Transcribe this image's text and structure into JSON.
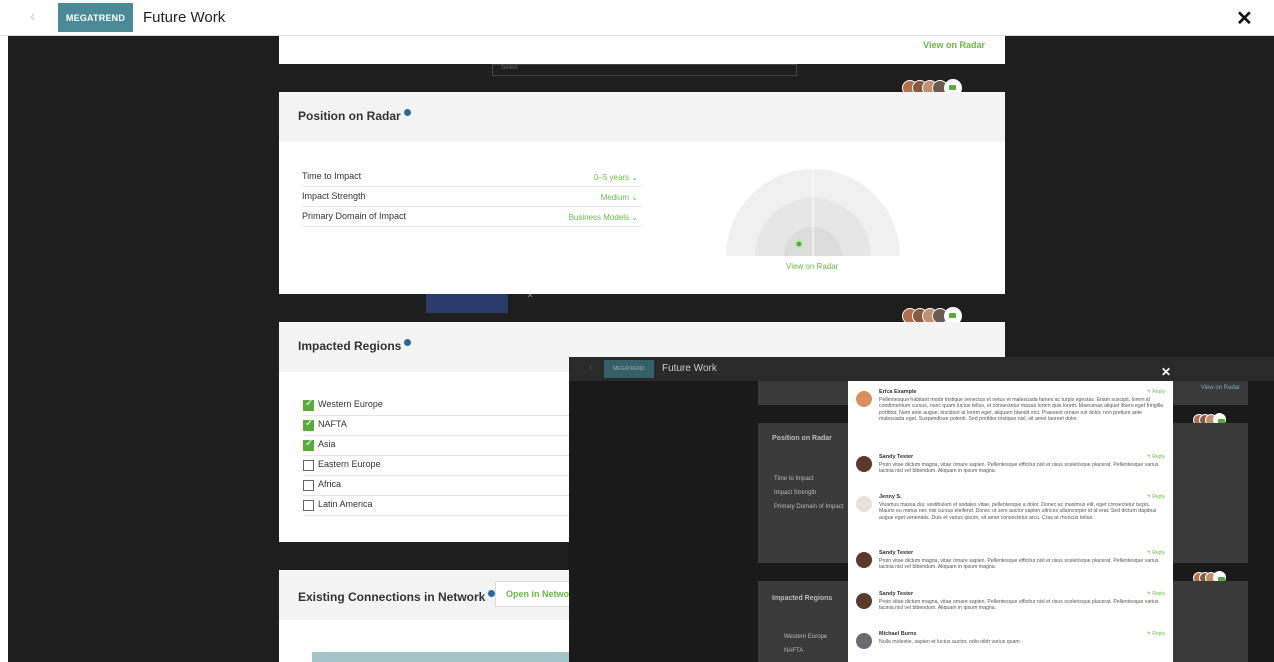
{
  "header": {
    "back_icon": "‹",
    "badge": "MEGATREND",
    "title": "Future Work",
    "close_icon": "✕"
  },
  "top_card": {
    "link": "View on Radar",
    "ghost_text": "Select"
  },
  "radar_card": {
    "title": "Position on Radar",
    "rows": [
      {
        "label": "Time to Impact",
        "value": "0–5 years"
      },
      {
        "label": "Impact Strength",
        "value": "Medium"
      },
      {
        "label": "Primary Domain of Impact",
        "value": "Business Models"
      }
    ],
    "link": "View on Radar"
  },
  "regions_card": {
    "title": "Impacted Regions",
    "items": [
      {
        "label": "Western Europe",
        "checked": true
      },
      {
        "label": "NAFTA",
        "checked": true
      },
      {
        "label": "Asia",
        "checked": true
      },
      {
        "label": "Eastern Europe",
        "checked": false
      },
      {
        "label": "Africa",
        "checked": false
      },
      {
        "label": "Latin America",
        "checked": false
      }
    ]
  },
  "connections_card": {
    "title": "Existing Connections in Network",
    "button": "Open in Netwo"
  },
  "overlay": {
    "badge": "MEGATREND",
    "title": "Future Work",
    "close_icon": "✕",
    "link": "View on Radar",
    "radar_title": "Position on Radar",
    "rows": [
      "Time to Impact",
      "Impact Strength",
      "Primary Domain of Impact"
    ],
    "regions_title": "Impacted Regions",
    "regions": [
      "Western Europe",
      "NAFTA"
    ],
    "comments": [
      {
        "name": "Erica Example",
        "reply": "↰ Reply",
        "text": "Pellentesque habitant morbi tristique senectus et netus et malesuada fames ac turpis egestas. Etiam suscipit, lorem id condimentum cursus, nunc quam luctus tellus, et consectetur massa lorem quis lorem. Maecenas aliquet libero eget fringilla porttitor. Nam ante augue, tincidunt at lorem eget, aliquam blandit orci. Praesent ornare est dolor, non pretium ante malesuada eget. Suspendisse potenti. Sed porttitor tristique nisl, sit amet laoreet dolor."
      },
      {
        "name": "Sandy Tester",
        "reply": "↰ Reply",
        "text": "Proin vitae dictum magna, vitae ornare sapien. Pellentesque efficitur nisl et risus scelerisque placerat. Pellentesque varius lacinia nisl vel bibendum. Aliquam in ipsum magna."
      },
      {
        "name": "Jenny S.",
        "reply": "↰ Reply",
        "text": "Vivamus massa dui, vestibulum et sodales vitae, pellentesque a dolor. Donec ac maximus elit, eget consectetur turpis. Mauris eu metus nec nisi cursus eleifend. Donec ut sem auctor sapien ultrices ullamcorper id id erat. Sed dictum dapibus augue eget venenatis. Duis et varius ipsum, sit amet consectetur arcu. Cras at rhoncus tellus."
      },
      {
        "name": "Sandy Tester",
        "reply": "↰ Reply",
        "text": "Proin vitae dictum magna, vitae ornare sapien. Pellentesque efficitur nisl et risus scelerisque placerat. Pellentesque varius lacinia nisl vel bibendum. Aliquam in ipsum magna."
      },
      {
        "name": "Sandy Tester",
        "reply": "↰ Reply",
        "text": "Proin vitae dictum magna, vitae ornare sapien. Pellentesque efficitur nisl et risus scelerisque placerat. Pellentesque varius lacinia nisl vel bibendum. Aliquam in ipsum magna."
      },
      {
        "name": "Michael Burns",
        "reply": "↰ Reply",
        "text": "Nulla molestie, sapien et luctus auctor, odio nibh varius quam."
      }
    ]
  },
  "colors": {
    "accent": "#6bb84a",
    "badge": "#4a8a97",
    "info": "#2a6a9a"
  }
}
